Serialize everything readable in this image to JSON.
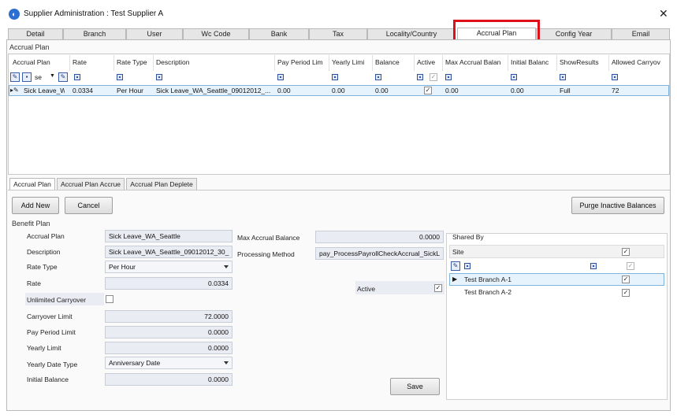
{
  "window": {
    "title": "Supplier Administration : Test Supplier A",
    "app_icon": "app-logo-icon",
    "close_glyph": "✕"
  },
  "tabs": [
    {
      "label": "Detail"
    },
    {
      "label": "Branch"
    },
    {
      "label": "User"
    },
    {
      "label": "Wc Code"
    },
    {
      "label": "Bank"
    },
    {
      "label": "Tax"
    },
    {
      "label": "Locality/Country"
    },
    {
      "label": "Accrual Plan"
    },
    {
      "label": "Config Year"
    },
    {
      "label": "Email"
    }
  ],
  "highlight_color": "#e0101a",
  "grid": {
    "section_title": "Accrual Plan",
    "columns": [
      "Accrual Plan",
      "Rate",
      "Rate Type",
      "Description",
      "Pay Period Lim",
      "Yearly Limi",
      "Balance",
      "Active",
      "Max Accrual Balan",
      "Initial Balanc",
      "ShowResults",
      "Allowed Carryov"
    ],
    "filter_text": "se",
    "row": {
      "accrual_plan": "Sick Leave_W",
      "rate": "0.0334",
      "rate_type": "Per Hour",
      "description": "Sick Leave_WA_Seattle_09012012_...",
      "pay_period_limit": "0.00",
      "yearly_limit": "0.00",
      "balance": "0.00",
      "active": "✓",
      "max_accrual_balance": "0.00",
      "initial_balance": "0.00",
      "show_results": "Full",
      "allowed_carryover": "72"
    }
  },
  "subtabs": [
    {
      "label": "Accrual  Plan"
    },
    {
      "label": "Accrual Plan Accrue"
    },
    {
      "label": "Accrual Plan Deplete"
    }
  ],
  "buttons": {
    "add_new": "Add New",
    "cancel": "Cancel",
    "purge": "Purge Inactive Balances",
    "save": "Save"
  },
  "benefit_plan": {
    "section_title": "Benefit Plan",
    "accrual_plan_label": "Accrual Plan",
    "accrual_plan_value": "Sick Leave_WA_Seattle",
    "description_label": "Description",
    "description_value": "Sick Leave_WA_Seattle_09012012_30_",
    "rate_type_label": "Rate Type",
    "rate_type_value": "Per Hour",
    "rate_label": "Rate",
    "rate_value": "0.0334",
    "unlimited_carryover_label": "Unlimited Carryover",
    "carryover_limit_label": "Carryover Limit",
    "carryover_limit_value": "72.0000",
    "pay_period_limit_label": "Pay Period Limit",
    "pay_period_limit_value": "0.0000",
    "yearly_limit_label": "Yearly Limit",
    "yearly_limit_value": "0.0000",
    "yearly_date_type_label": "Yearly Date Type",
    "yearly_date_type_value": "Anniversary Date",
    "initial_balance_label": "Initial Balance",
    "initial_balance_value": "0.0000",
    "max_accrual_balance_label": "Max Accrual Balance",
    "max_accrual_balance_value": "0.0000",
    "processing_method_label": "Processing Method",
    "processing_method_value": "pay_ProcessPayrollCheckAccrual_SickL",
    "active_label": "Active",
    "active_checked": "✓"
  },
  "shared_by": {
    "title": "Shared By",
    "column": "Site",
    "rows": [
      {
        "name": "Test Branch A-1",
        "checked": "✓"
      },
      {
        "name": "Test Branch A-2",
        "checked": "✓"
      }
    ]
  }
}
